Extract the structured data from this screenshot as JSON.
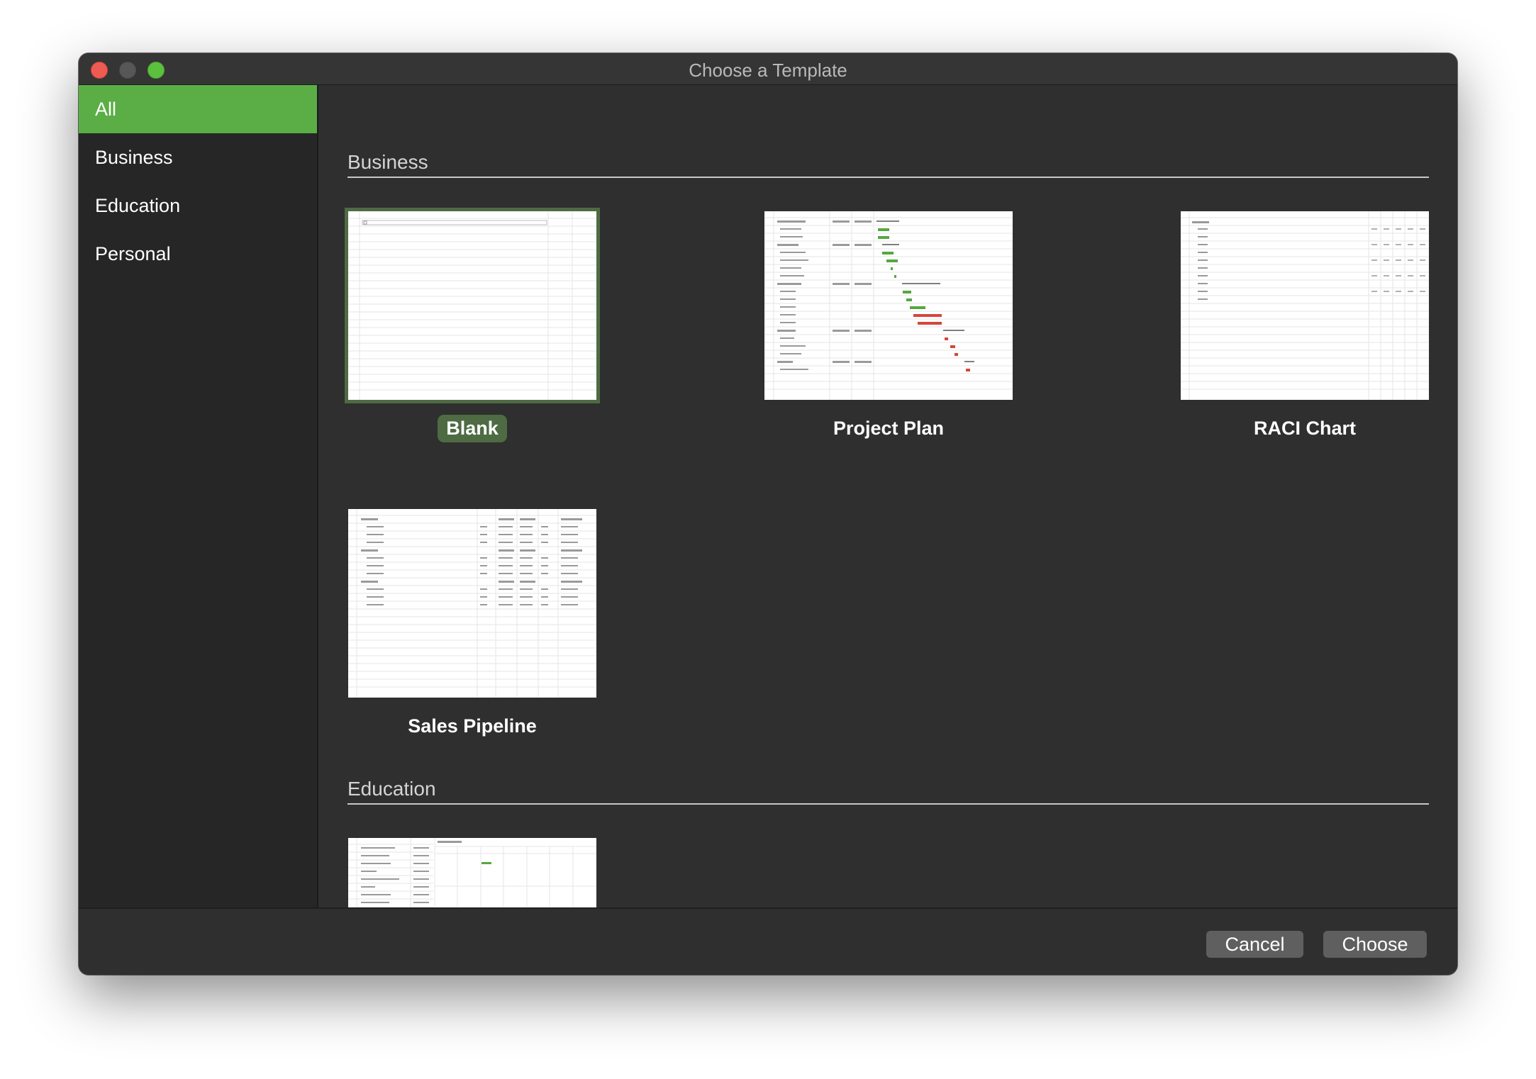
{
  "window": {
    "title": "Choose a Template"
  },
  "sidebar": {
    "items": [
      {
        "label": "All",
        "selected": true
      },
      {
        "label": "Business",
        "selected": false
      },
      {
        "label": "Education",
        "selected": false
      },
      {
        "label": "Personal",
        "selected": false
      }
    ]
  },
  "sections": [
    {
      "title": "Business",
      "templates": [
        {
          "name": "Blank",
          "selected": true
        },
        {
          "name": "Project Plan",
          "selected": false
        },
        {
          "name": "RACI Chart",
          "selected": false
        },
        {
          "name": "Sales Pipeline",
          "selected": false
        }
      ]
    },
    {
      "title": "Education",
      "templates": [
        {
          "name": "",
          "selected": false
        }
      ]
    }
  ],
  "footer": {
    "cancel_label": "Cancel",
    "choose_label": "Choose"
  },
  "colors": {
    "accent": "#5aae45",
    "selected_highlight": "#4e6b43",
    "window_bg": "#2f2f2f",
    "sidebar_bg": "#262626",
    "gantt_green": "#56a83e",
    "gantt_red": "#d4473a"
  }
}
